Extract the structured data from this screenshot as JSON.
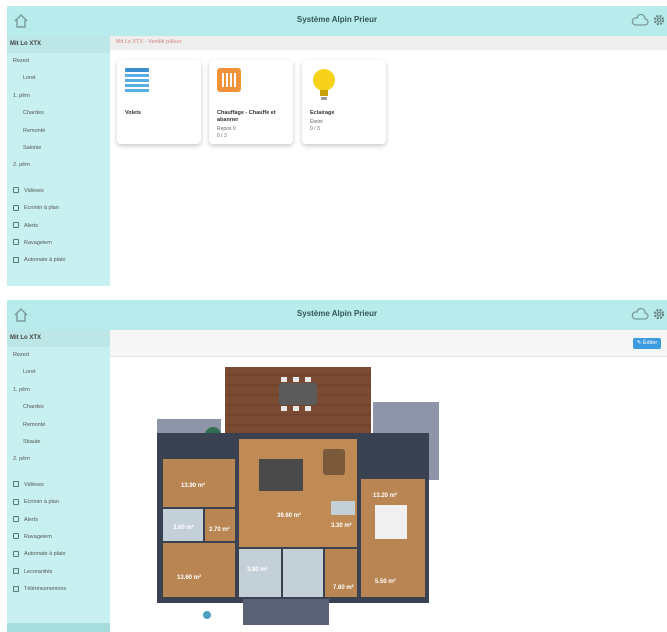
{
  "app": {
    "title": "Système Alpin Prieur",
    "icons": {
      "home": "home-icon",
      "cloud": "cloud-icon",
      "settings": "gear-icon"
    }
  },
  "screen1": {
    "sidebar": {
      "site": "Mit Lo XTX",
      "items": [
        {
          "label": "Rezed",
          "level": 0
        },
        {
          "label": "Loret",
          "level": 1
        },
        {
          "label": "1. pêm",
          "level": 0
        },
        {
          "label": "Chardes",
          "level": 1
        },
        {
          "label": "Remonté",
          "level": 1
        },
        {
          "label": "Salonie",
          "level": 1
        },
        {
          "label": "2. pêm",
          "level": 0
        }
      ],
      "tools": [
        {
          "label": "Vidéoes",
          "icon": "gear-icon"
        },
        {
          "label": "Ecrimin à plan",
          "icon": "calendar-icon"
        },
        {
          "label": "Alerts",
          "icon": "alert-icon"
        },
        {
          "label": "Ravageiem",
          "icon": "car-icon"
        },
        {
          "label": "Automate à plato",
          "icon": "grid-icon"
        }
      ]
    },
    "breadcrumb": "Mit Lo XTX - Ventilé pâleur",
    "cards": [
      {
        "title": "Volets",
        "subtitle": "",
        "detail": "",
        "icon": "shutter-icon"
      },
      {
        "title": "Chauffage - Chauffe et abanner",
        "subtitle": "Repos 0",
        "detail": "0 / 3",
        "icon": "heating-icon"
      },
      {
        "title": "Eclairage",
        "subtitle": "Éteint",
        "detail": "0 / 3",
        "icon": "bulb-icon"
      }
    ]
  },
  "screen2": {
    "sidebar": {
      "site": "Mit Lo XTX",
      "items": [
        {
          "label": "Rezed",
          "level": 0
        },
        {
          "label": "Loret",
          "level": 1
        },
        {
          "label": "1. pêm",
          "level": 0
        },
        {
          "label": "Chardes",
          "level": 1
        },
        {
          "label": "Remonté",
          "level": 1
        },
        {
          "label": "Sbaute",
          "level": 1
        },
        {
          "label": "2. pêm",
          "level": 0
        }
      ],
      "tools": [
        {
          "label": "Vidéoes",
          "icon": "gear-icon"
        },
        {
          "label": "Ecrimin à plan",
          "icon": "calendar-icon"
        },
        {
          "label": "Alerts",
          "icon": "alert-icon"
        },
        {
          "label": "Ravageiem",
          "icon": "car-icon"
        },
        {
          "label": "Automate à plato",
          "icon": "grid-icon"
        },
        {
          "label": "Lecoranités",
          "icon": "list-icon"
        },
        {
          "label": "Télérésumenions",
          "icon": "phone-icon"
        }
      ]
    },
    "edit_button": "✎ Éditer",
    "floorplan": {
      "rooms": [
        {
          "label": "13.90 m²"
        },
        {
          "label": "3.60 m²"
        },
        {
          "label": "2.70 m²"
        },
        {
          "label": "39.60 m²"
        },
        {
          "label": "3.30 m²"
        },
        {
          "label": "13.20 m²"
        },
        {
          "label": "13.60 m²"
        },
        {
          "label": "3.80 m²"
        },
        {
          "label": "7.60 m²"
        },
        {
          "label": "5.50 m²"
        }
      ]
    }
  },
  "colors": {
    "topbar": "#b8ecec",
    "sidebar": "#c8f0f0",
    "accent": "#3d9be0",
    "breadcrumb_text": "#d58484",
    "heating": "#f0923a",
    "bulb": "#f7d21a"
  }
}
